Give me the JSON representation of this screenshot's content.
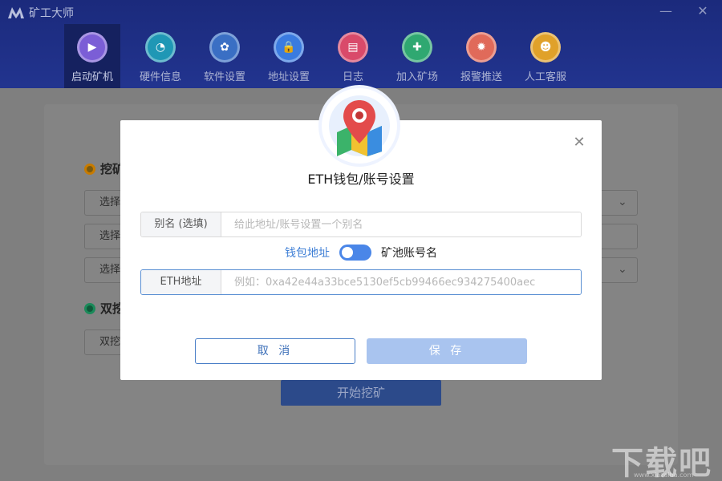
{
  "app": {
    "title": "矿工大师"
  },
  "window": {
    "minimize_icon": "—",
    "close_icon": "✕"
  },
  "nav": {
    "items": [
      {
        "label": "启动矿机",
        "icon": "monitor-icon",
        "color": "#7b5ed6",
        "glyph": "▶"
      },
      {
        "label": "硬件信息",
        "icon": "gauge-icon",
        "color": "#1f97b5",
        "glyph": "◔"
      },
      {
        "label": "软件设置",
        "icon": "gear-icon",
        "color": "#3a6fc4",
        "glyph": "✿"
      },
      {
        "label": "地址设置",
        "icon": "lock-icon",
        "color": "#3a7be0",
        "glyph": "🔒"
      },
      {
        "label": "日志",
        "icon": "document-icon",
        "color": "#d94a6a",
        "glyph": "▤"
      },
      {
        "label": "加入矿场",
        "icon": "join-icon",
        "color": "#2fa871",
        "glyph": "✚"
      },
      {
        "label": "报警推送",
        "icon": "alarm-icon",
        "color": "#e06a5a",
        "glyph": "✹"
      },
      {
        "label": "人工客服",
        "icon": "support-icon",
        "color": "#e0a12a",
        "glyph": "☻"
      }
    ]
  },
  "background": {
    "section1_title": "挖矿",
    "select1": "选择",
    "select2": "选择",
    "select3": "选择",
    "section2_title": "双挖",
    "select4": "双挖",
    "start_button": "开始挖矿"
  },
  "modal": {
    "title": "ETH钱包/账号设置",
    "badge_icon": "map-pin-icon",
    "alias_label": "别名 (选填)",
    "alias_placeholder": "给此地址/账号设置一个别名",
    "toggle_left": "钱包地址",
    "toggle_right": "矿池账号名",
    "eth_label": "ETH地址",
    "eth_placeholder": "例如：0xa42e44a33bce5130ef5cb99466ec934275400aec",
    "cancel": "取 消",
    "save": "保 存"
  },
  "watermark": {
    "text": "下载吧",
    "sub": "www.xiazaiba.com"
  }
}
